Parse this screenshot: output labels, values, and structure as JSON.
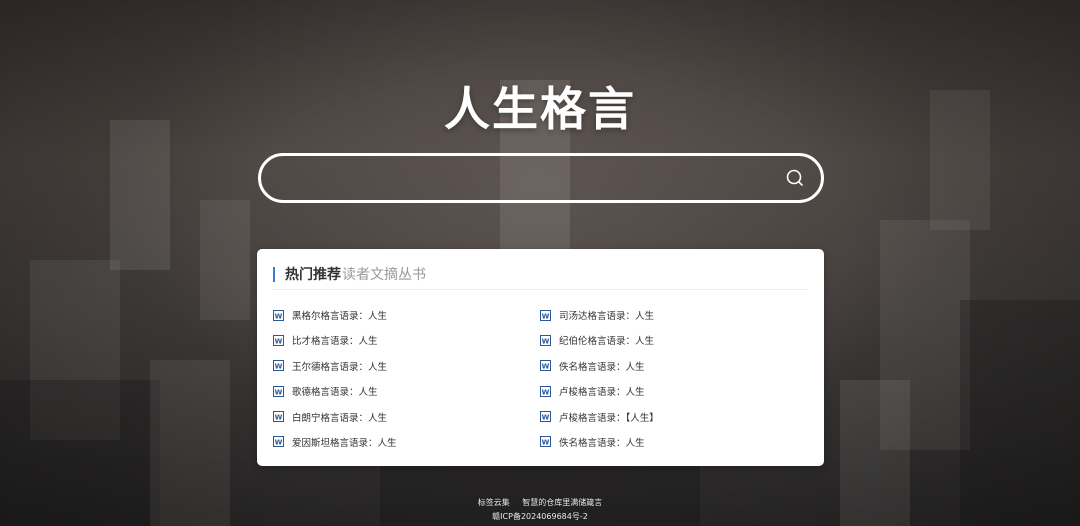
{
  "site": {
    "title": "人生格言"
  },
  "search": {
    "placeholder": "",
    "value": ""
  },
  "panel": {
    "title": "热门推荐",
    "subtitle": "读者文摘丛书"
  },
  "articles_left": [
    {
      "label": "黑格尔格言语录：人生"
    },
    {
      "label": "比才格言语录：人生"
    },
    {
      "label": "王尔德格言语录：人生"
    },
    {
      "label": "歌德格言语录：人生"
    },
    {
      "label": "白朗宁格言语录：人生"
    },
    {
      "label": "爱因斯坦格言语录：人生"
    }
  ],
  "articles_right": [
    {
      "label": "司汤达格言语录：人生"
    },
    {
      "label": "纪伯伦格言语录：人生"
    },
    {
      "label": "佚名格言语录：人生"
    },
    {
      "label": "卢梭格言语录：人生"
    },
    {
      "label": "卢梭格言语录：【人生】"
    },
    {
      "label": "佚名格言语录：人生"
    }
  ],
  "footer": {
    "links": [
      {
        "label": "标签云集"
      },
      {
        "label": "智慧的仓库里满储箴言"
      }
    ],
    "icp": "赣ICP备2024069684号-2"
  },
  "colors": {
    "accent": "#2f7fd0",
    "doc_icon": "#2b5797"
  },
  "icons": {
    "search": "search-icon",
    "document": "word-doc-icon"
  }
}
